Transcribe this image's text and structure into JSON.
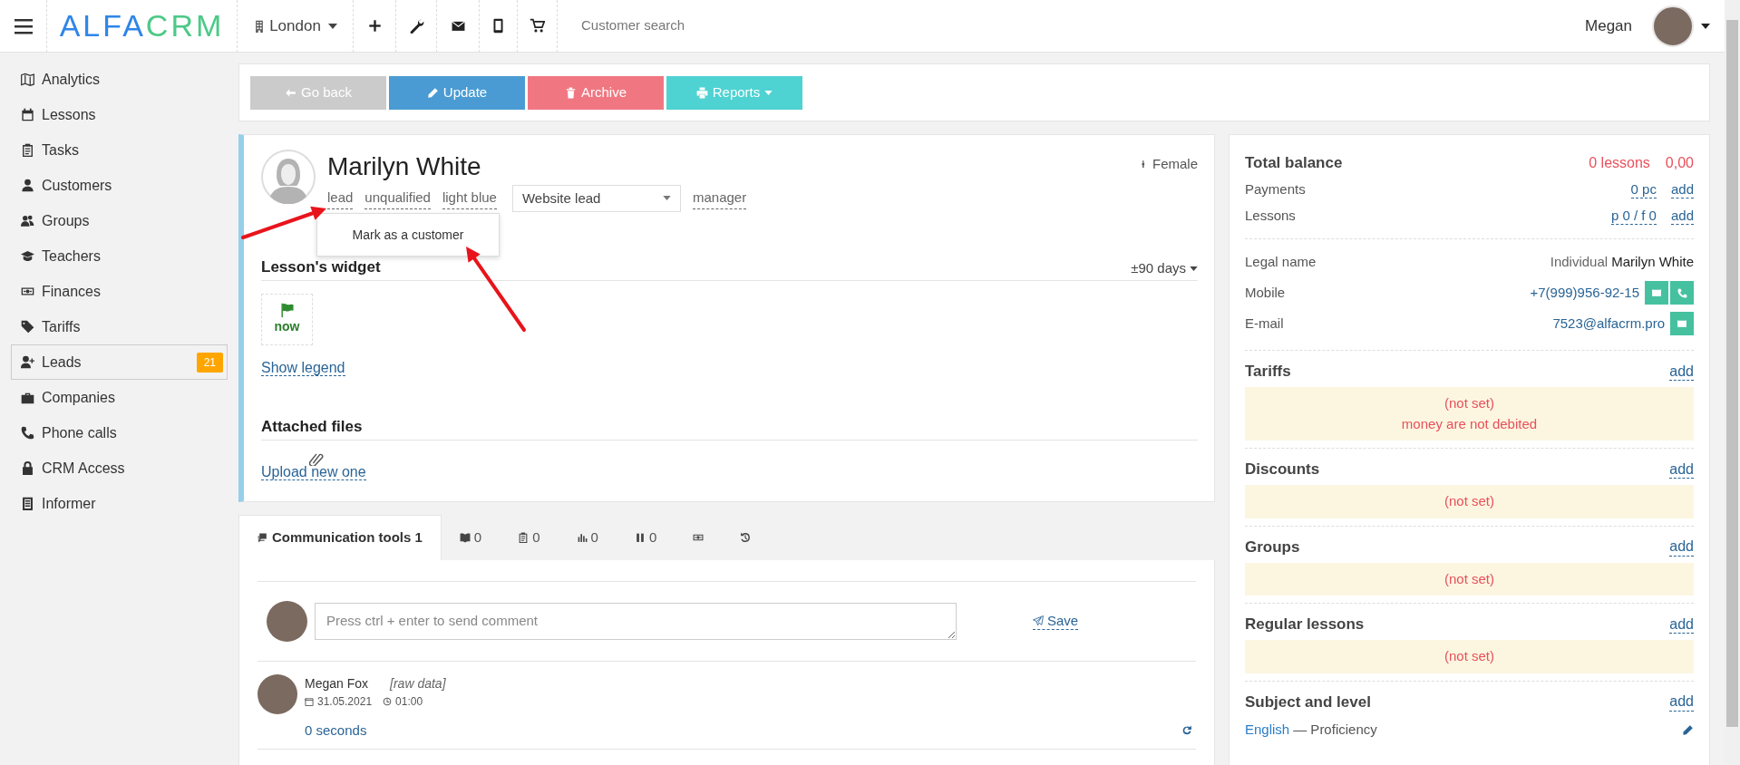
{
  "topbar": {
    "logo_parts": [
      "ALFA",
      "CRM"
    ],
    "branch": "London",
    "search_placeholder": "Customer search",
    "user": "Megan"
  },
  "sidebar": {
    "items": [
      {
        "label": "Analytics",
        "selected": false
      },
      {
        "label": "Lessons",
        "selected": false
      },
      {
        "label": "Tasks",
        "selected": false
      },
      {
        "label": "Customers",
        "selected": false
      },
      {
        "label": "Groups",
        "selected": false
      },
      {
        "label": "Teachers",
        "selected": false
      },
      {
        "label": "Finances",
        "selected": false
      },
      {
        "label": "Tariffs",
        "selected": false
      },
      {
        "label": "Leads",
        "selected": true,
        "badge": "21"
      },
      {
        "label": "Companies",
        "selected": false
      },
      {
        "label": "Phone calls",
        "selected": false
      },
      {
        "label": "CRM Access",
        "selected": false
      },
      {
        "label": "Informer",
        "selected": false
      }
    ]
  },
  "toolbar": {
    "buttons": [
      {
        "label": "Go back",
        "kind": "back"
      },
      {
        "label": "Update",
        "kind": "update"
      },
      {
        "label": "Archive",
        "kind": "archive"
      },
      {
        "label": "Reports",
        "kind": "reports"
      }
    ]
  },
  "profile": {
    "name": "Marilyn White",
    "gender": "Female",
    "tags": [
      {
        "label": "lead"
      },
      {
        "label": "unqualified"
      },
      {
        "label": "light blue"
      }
    ],
    "source": "Website lead",
    "manager": "manager",
    "menu": {
      "items": [
        "Mark as a customer"
      ]
    }
  },
  "lessons_widget": {
    "title": "Lesson's widget",
    "range": "±90 days",
    "day": "now",
    "legend_link": "Show legend"
  },
  "attached_files": {
    "title": "Attached files",
    "upload_link": "Upload new one"
  },
  "tabs": [
    {
      "label": "Communication tools 1",
      "selected": true
    },
    {
      "label": "0",
      "selected": false
    },
    {
      "label": "0",
      "selected": false
    },
    {
      "label": "0",
      "selected": false
    },
    {
      "label": "0",
      "selected": false
    },
    {
      "selected": false
    },
    {
      "selected": false
    }
  ],
  "comment": {
    "placeholder": "Press ctrl + enter to send comment",
    "save": "Save"
  },
  "feed": [
    {
      "author": "Megan Fox",
      "note": "[raw data]",
      "date": "31.05.2021",
      "time": "01:00",
      "ago": "0 seconds"
    }
  ],
  "balance": {
    "title": "Total balance",
    "lessons": "0 lessons",
    "amount": "0,00",
    "rows": [
      {
        "label": "Payments",
        "value": "0 pc",
        "action": "add"
      },
      {
        "label": "Lessons",
        "value": "p 0 / f 0",
        "action": "add"
      }
    ]
  },
  "contacts": [
    {
      "kind": "legal",
      "label": "Legal name",
      "prefix": "Individual",
      "value": "Marilyn White"
    },
    {
      "kind": "phone",
      "label": "Mobile",
      "value": "+7(999)956-92-15"
    },
    {
      "kind": "email",
      "label": "E-mail",
      "value": "7523@alfacrm.pro"
    }
  ],
  "sections": [
    {
      "kind": "empty",
      "title": "Tariffs",
      "action": "add",
      "empty": "(not set)",
      "note": "money are not debited"
    },
    {
      "kind": "empty",
      "title": "Discounts",
      "action": "add",
      "empty": "(not set)"
    },
    {
      "kind": "empty",
      "title": "Groups",
      "action": "add",
      "empty": "(not set)"
    },
    {
      "kind": "empty",
      "title": "Regular lessons",
      "action": "add",
      "empty": "(not set)"
    },
    {
      "kind": "entries",
      "title": "Subject and level",
      "action": "add",
      "entries": [
        {
          "subject": "English",
          "level": "— Proficiency"
        }
      ]
    }
  ],
  "annotations": [
    {
      "kind": "arrow"
    },
    {
      "kind": "arrow"
    }
  ]
}
